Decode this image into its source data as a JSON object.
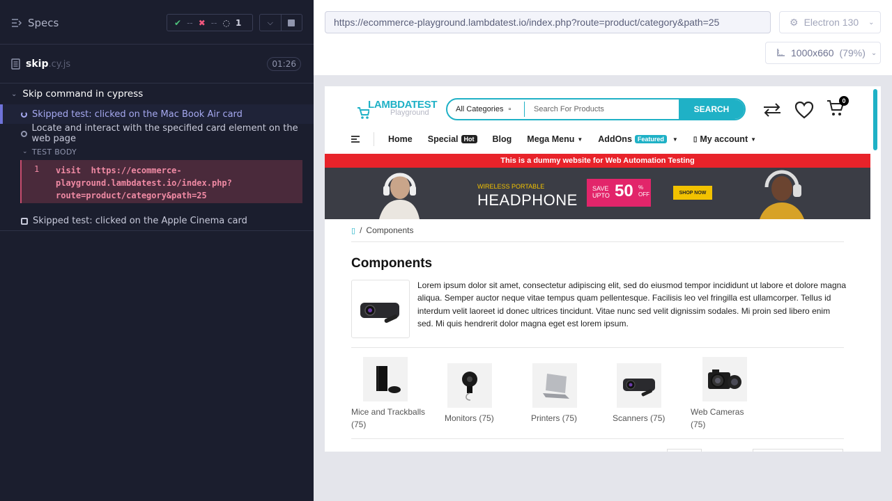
{
  "reporter": {
    "specs_label": "Specs",
    "stats": {
      "passed": "--",
      "failed": "--",
      "pending": "1"
    },
    "spec": {
      "name": "skip",
      "ext": ".cy.js",
      "duration": "01:26"
    },
    "suite_title": "Skip command in cypress",
    "tests": [
      {
        "title": "Skipped test: clicked on the Mac Book Air card"
      },
      {
        "title": "Locate and interact with the specified card element on the web page"
      }
    ],
    "test_body_label": "TEST BODY",
    "command": {
      "number": "1",
      "text_lines": [
        "visit  https://ecommerce-",
        "playground.lambdatest.io/index.php?",
        "route=product/category&path=25"
      ]
    },
    "skipped_test": "Skipped test: clicked on the Apple Cinema card"
  },
  "aut": {
    "url": "https://ecommerce-playground.lambdatest.io/index.php?route=product/category&path=25",
    "browser": "Electron 130",
    "viewport": "1000x660",
    "viewport_pct": "(79%)"
  },
  "site": {
    "logo_main": "LAMBDATEST",
    "logo_sub": "Playground",
    "search": {
      "category": "All Categories",
      "placeholder": "Search For Products",
      "button": "SEARCH"
    },
    "cart_count": "0",
    "nav": {
      "home": "Home",
      "special": "Special",
      "special_tag": "Hot",
      "blog": "Blog",
      "mega_menu": "Mega Menu",
      "addons": "AddOns",
      "addons_tag": "Featured",
      "account": "My account"
    },
    "notice": "This is a dummy website for Web Automation Testing",
    "banner": {
      "sub": "WIRELESS PORTABLE",
      "main": "HEADPHONE",
      "save": "SAVE",
      "upto": "UPTO",
      "pct": "50",
      "pct_sign": "%",
      "off": "OFF",
      "shop": "SHOP NOW"
    },
    "breadcrumb": "Components",
    "heading": "Components",
    "description": "Lorem ipsum dolor sit amet, consectetur adipiscing elit, sed do eiusmod tempor incididunt ut labore et dolore magna aliqua. Semper auctor neque vitae tempus quam pellentesque. Facilisis leo vel fringilla est ullamcorper. Tellus id interdum velit laoreet id donec ultrices tincidunt. Vitae nunc sed velit dignissim sodales. Mi proin sed libero enim sed. Mi quis hendrerit dolor magna eget est lorem ipsum.",
    "subcategories": [
      {
        "label": "Mice and Trackballs (75)"
      },
      {
        "label": "Monitors (75)"
      },
      {
        "label": "Printers (75)"
      },
      {
        "label": "Scanners (75)"
      },
      {
        "label": "Web Cameras (75)"
      }
    ]
  }
}
